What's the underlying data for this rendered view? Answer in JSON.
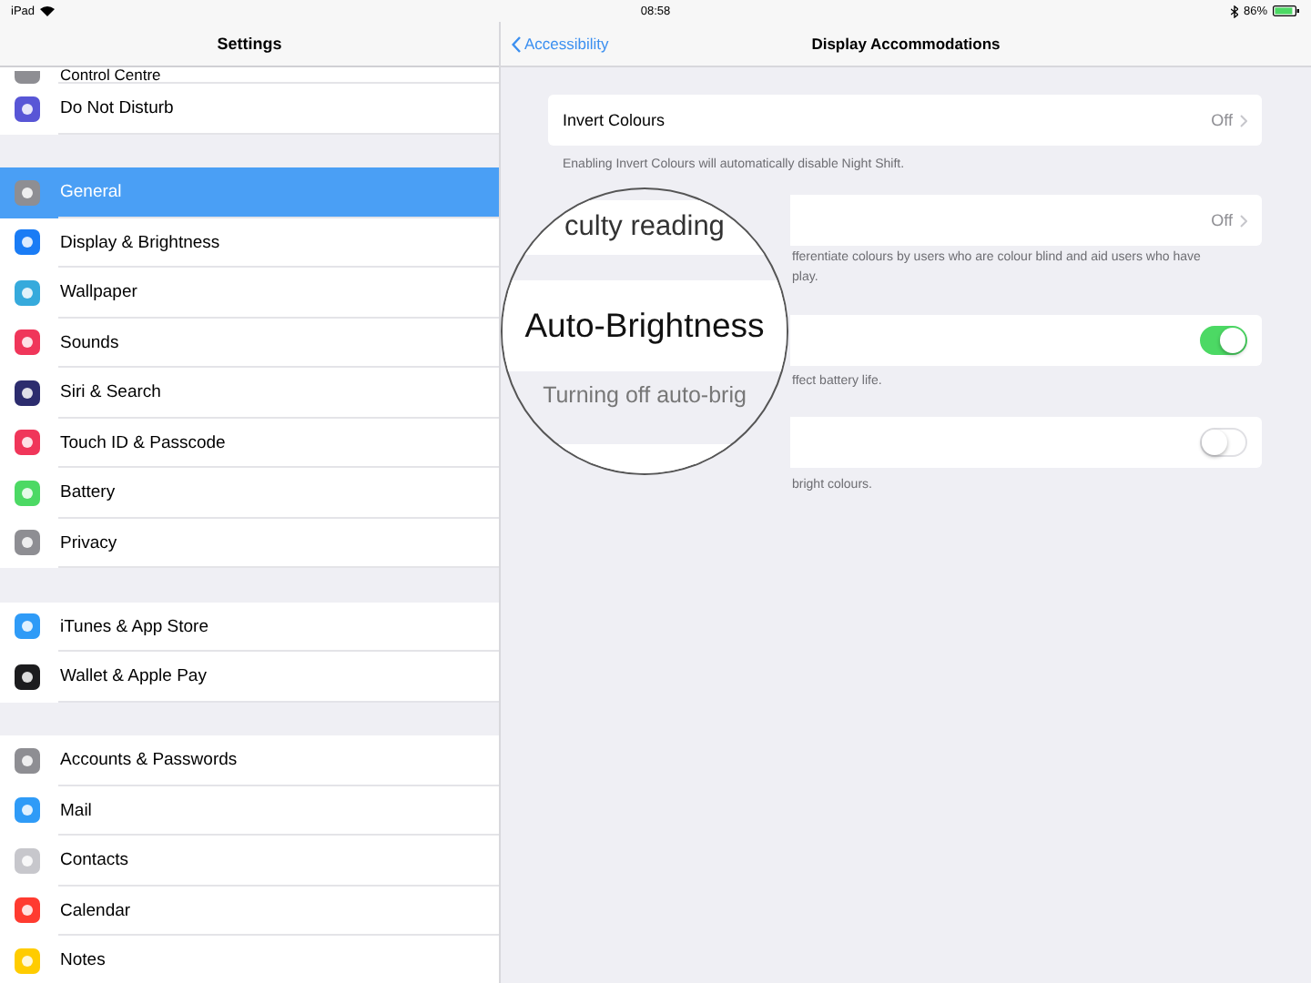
{
  "status_bar": {
    "device": "iPad",
    "time": "08:58",
    "battery": "86%"
  },
  "sidebar": {
    "title": "Settings",
    "groups": [
      {
        "items": [
          {
            "label": "Control Centre",
            "color": "#8e8e93",
            "selected": false
          },
          {
            "label": "Do Not Disturb",
            "color": "#5856d6",
            "selected": false
          }
        ]
      },
      {
        "items": [
          {
            "label": "General",
            "color": "#8e8e93",
            "selected": true
          },
          {
            "label": "Display & Brightness",
            "color": "#1a7cf5",
            "selected": false
          },
          {
            "label": "Wallpaper",
            "color": "#36aadc",
            "selected": false
          },
          {
            "label": "Sounds",
            "color": "#f0365a",
            "selected": false
          },
          {
            "label": "Siri & Search",
            "color": "#2c2c6e",
            "selected": false
          },
          {
            "label": "Touch ID & Passcode",
            "color": "#f0365a",
            "selected": false
          },
          {
            "label": "Battery",
            "color": "#4cd964",
            "selected": false
          },
          {
            "label": "Privacy",
            "color": "#8e8e93",
            "selected": false
          }
        ]
      },
      {
        "items": [
          {
            "label": "iTunes & App Store",
            "color": "#2f9bf7",
            "selected": false
          },
          {
            "label": "Wallet & Apple Pay",
            "color": "#1c1c1e",
            "selected": false
          }
        ]
      },
      {
        "items": [
          {
            "label": "Accounts & Passwords",
            "color": "#8e8e93",
            "selected": false
          },
          {
            "label": "Mail",
            "color": "#2f9bf7",
            "selected": false
          },
          {
            "label": "Contacts",
            "color": "#c7c7cc",
            "selected": false
          },
          {
            "label": "Calendar",
            "color": "#ff3b30",
            "selected": false
          },
          {
            "label": "Notes",
            "color": "#ffcc00",
            "selected": false
          }
        ]
      }
    ]
  },
  "detail": {
    "back": "Accessibility",
    "title": "Display Accommodations",
    "rows": [
      {
        "kind": "value",
        "label": "Invert Colours",
        "value": "Off",
        "footer": [
          "Enabling Invert Colours will automatically disable Night Shift."
        ]
      },
      {
        "kind": "value",
        "value": "Off",
        "footer": [
          "fferentiate colours by users who are colour blind and aid users who have",
          "play."
        ]
      },
      {
        "kind": "toggle",
        "on": true,
        "footer": [
          "ffect battery life."
        ]
      },
      {
        "kind": "toggle",
        "on": false,
        "footer": [
          "bright colours."
        ]
      }
    ]
  },
  "magnifier": {
    "texts": [
      "culty reading",
      "Auto-Brightness",
      "Turning off auto-brig"
    ]
  }
}
